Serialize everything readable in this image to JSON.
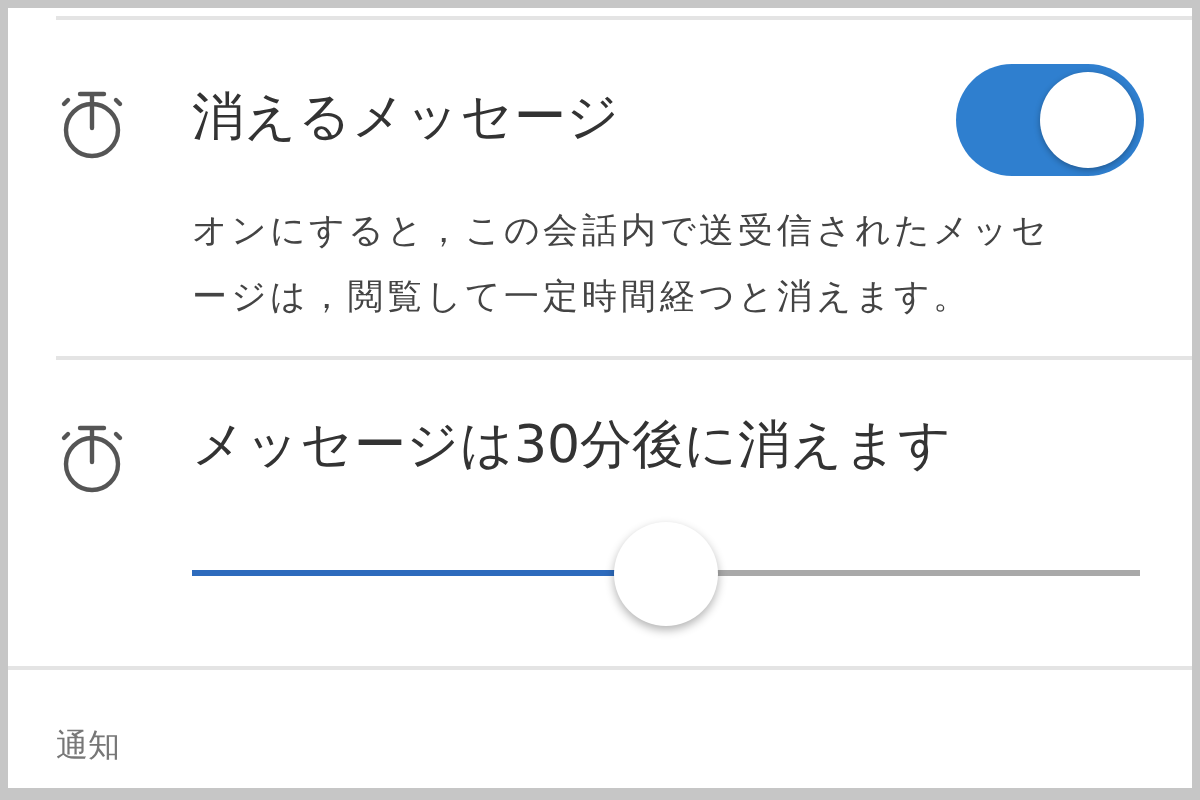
{
  "settings": [
    {
      "kind": "toggle",
      "title": "消えるメッセージ",
      "on": true,
      "description": "オンにすると，この会話内で送受信されたメッセージは，閲覧して一定時間経つと消えます。"
    },
    {
      "kind": "slider",
      "title": "メッセージは30分後に消えます",
      "level": 0.5
    }
  ],
  "section_header": "通知"
}
